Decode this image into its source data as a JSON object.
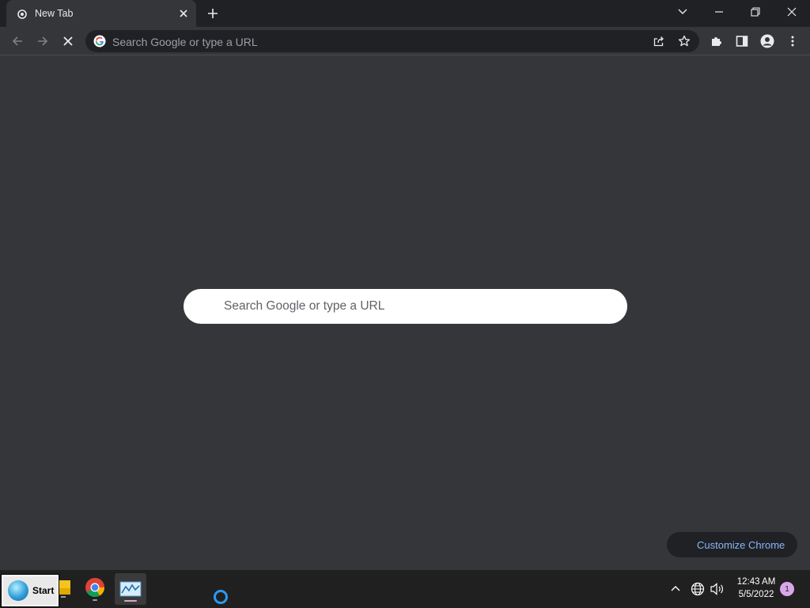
{
  "tab": {
    "title": "New Tab"
  },
  "toolbar": {
    "omnibox_placeholder": "Search Google or type a URL"
  },
  "ntp": {
    "search_placeholder": "Search Google or type a URL",
    "customize_label": "Customize Chrome"
  },
  "taskbar": {
    "start_label": "Start",
    "time": "12:43 AM",
    "date": "5/5/2022",
    "notification_count": "1"
  },
  "colors": {
    "frame": "#202124",
    "toolbar": "#35363a",
    "content": "#35363a",
    "accent_link": "#8ab4f8",
    "taskbar": "#202020"
  }
}
